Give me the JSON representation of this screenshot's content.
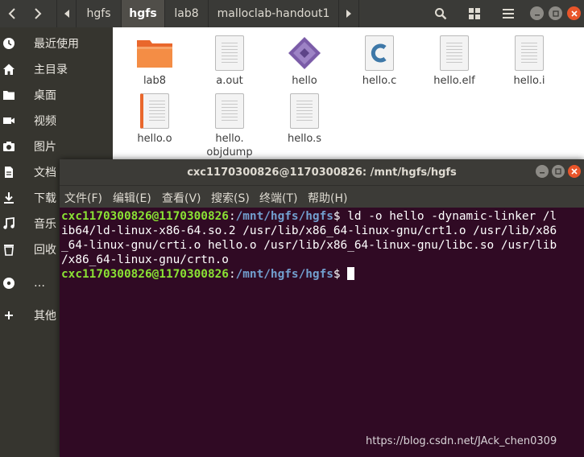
{
  "file_manager": {
    "nav": {
      "back_icon": "chevron-left-icon",
      "forward_icon": "chevron-right-icon",
      "scroll_left_icon": "triangle-left-icon",
      "scroll_right_icon": "triangle-right-icon"
    },
    "breadcrumbs": [
      "hgfs",
      "hgfs",
      "lab8",
      "malloclab-handout1"
    ],
    "active_crumb": "hgfs",
    "header_icons": [
      "search-icon",
      "view-grid-icon",
      "hamburger-menu-icon"
    ],
    "sidebar": [
      {
        "label": "最近使用",
        "icon": "clock-icon"
      },
      {
        "label": "主目录",
        "icon": "home-icon"
      },
      {
        "label": "桌面",
        "icon": "folder-icon"
      },
      {
        "label": "视频",
        "icon": "video-icon"
      },
      {
        "label": "图片",
        "icon": "camera-icon"
      },
      {
        "label": "文档",
        "icon": "document-icon"
      },
      {
        "label": "下载",
        "icon": "download-icon"
      },
      {
        "label": "音乐",
        "icon": "music-icon"
      },
      {
        "label": "回收",
        "icon": "trash-icon"
      },
      {
        "label": "…",
        "icon": "disc-icon"
      },
      {
        "label": "其他",
        "icon": "plus-icon"
      }
    ],
    "files": [
      {
        "name": "lab8",
        "type": "folder"
      },
      {
        "name": "a.out",
        "type": "document"
      },
      {
        "name": "hello",
        "type": "executable"
      },
      {
        "name": "hello.c",
        "type": "c-source"
      },
      {
        "name": "hello.elf",
        "type": "document"
      },
      {
        "name": "hello.i",
        "type": "document"
      },
      {
        "name": "hello.o",
        "type": "object"
      },
      {
        "name": "hello.\nobjdump",
        "type": "document"
      },
      {
        "name": "hello.s",
        "type": "document"
      }
    ]
  },
  "terminal": {
    "title": "cxc1170300826@1170300826: /mnt/hgfs/hgfs",
    "menu": [
      "文件(F)",
      "编辑(E)",
      "查看(V)",
      "搜索(S)",
      "终端(T)",
      "帮助(H)"
    ],
    "prompt_user": "cxc1170300826@1170300826",
    "prompt_path": "/mnt/hgfs/hgfs",
    "command_line1": "$ ld -o hello -dynamic-linker /l",
    "command_cont": [
      "ib64/ld-linux-x86-64.so.2 /usr/lib/x86_64-linux-gnu/crt1.o /usr/lib/x86",
      "_64-linux-gnu/crti.o hello.o /usr/lib/x86_64-linux-gnu/libc.so /usr/lib",
      "/x86_64-linux-gnu/crtn.o"
    ],
    "prompt2_suffix": "$ ",
    "colors": {
      "background": "#300a24",
      "user": "#8ae234",
      "path": "#729fcf"
    }
  },
  "watermark": "https://blog.csdn.net/JAck_chen0309"
}
